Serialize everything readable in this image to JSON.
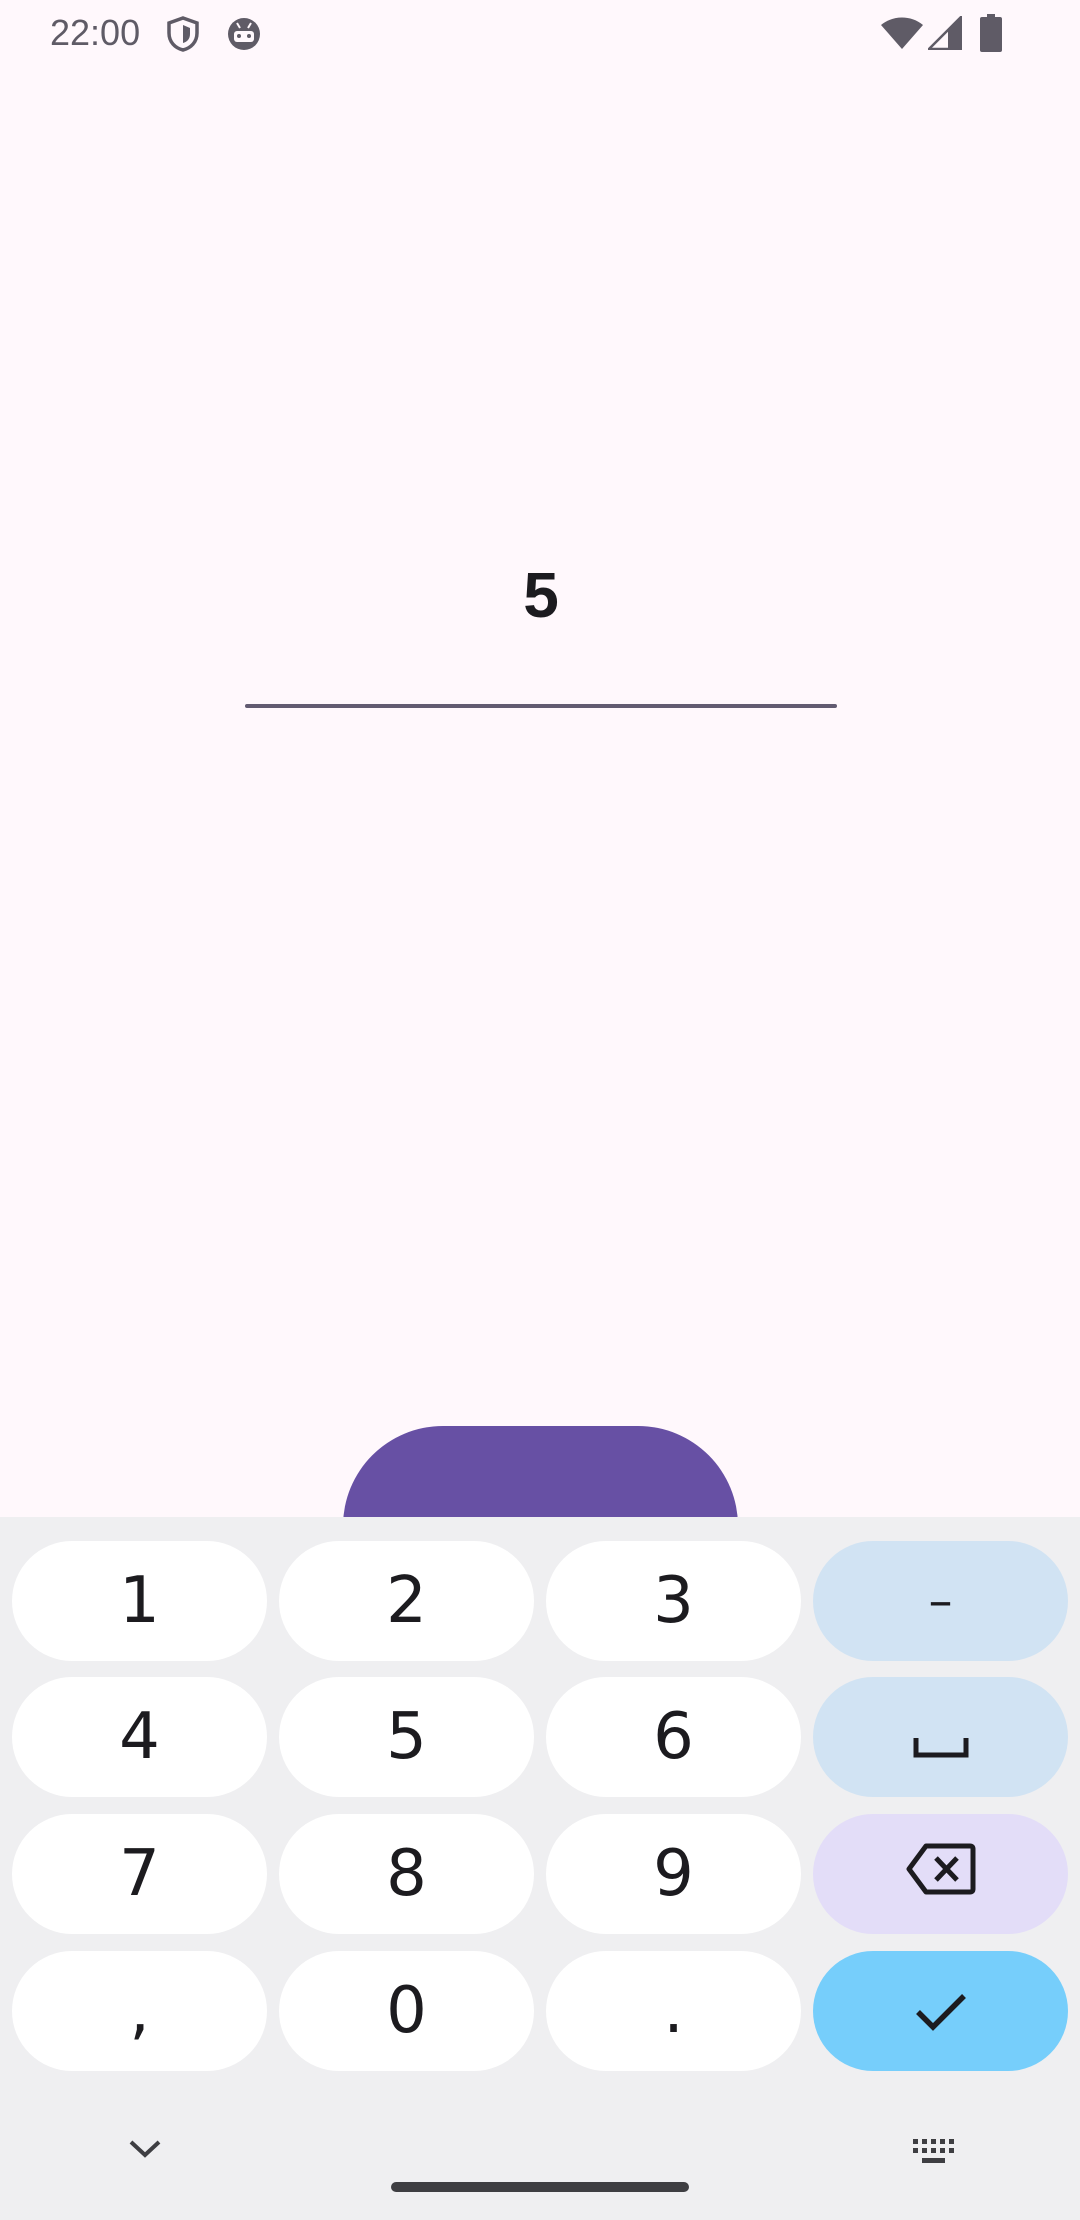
{
  "status_bar": {
    "time": "22:00",
    "icons_left": [
      "shield-icon",
      "android-robot-icon"
    ],
    "icons_right": [
      "wifi-icon",
      "signal-icon",
      "battery-icon"
    ]
  },
  "input": {
    "value": "5"
  },
  "keyboard": {
    "rows": [
      [
        {
          "label": "1"
        },
        {
          "label": "2"
        },
        {
          "label": "3"
        },
        {
          "label": "–",
          "kind": "func"
        }
      ],
      [
        {
          "label": "4"
        },
        {
          "label": "5"
        },
        {
          "label": "6"
        },
        {
          "label": "␣",
          "kind": "func"
        }
      ],
      [
        {
          "label": "7"
        },
        {
          "label": "8"
        },
        {
          "label": "9"
        },
        {
          "label": "",
          "kind": "del"
        }
      ],
      [
        {
          "label": ","
        },
        {
          "label": "0"
        },
        {
          "label": "."
        },
        {
          "label": "",
          "kind": "enter"
        }
      ]
    ]
  },
  "colors": {
    "background": "#FFF8FC",
    "accent": "#6750A4",
    "keyboard_bg": "#EFEFF1",
    "enter_key": "#76CEFB"
  }
}
